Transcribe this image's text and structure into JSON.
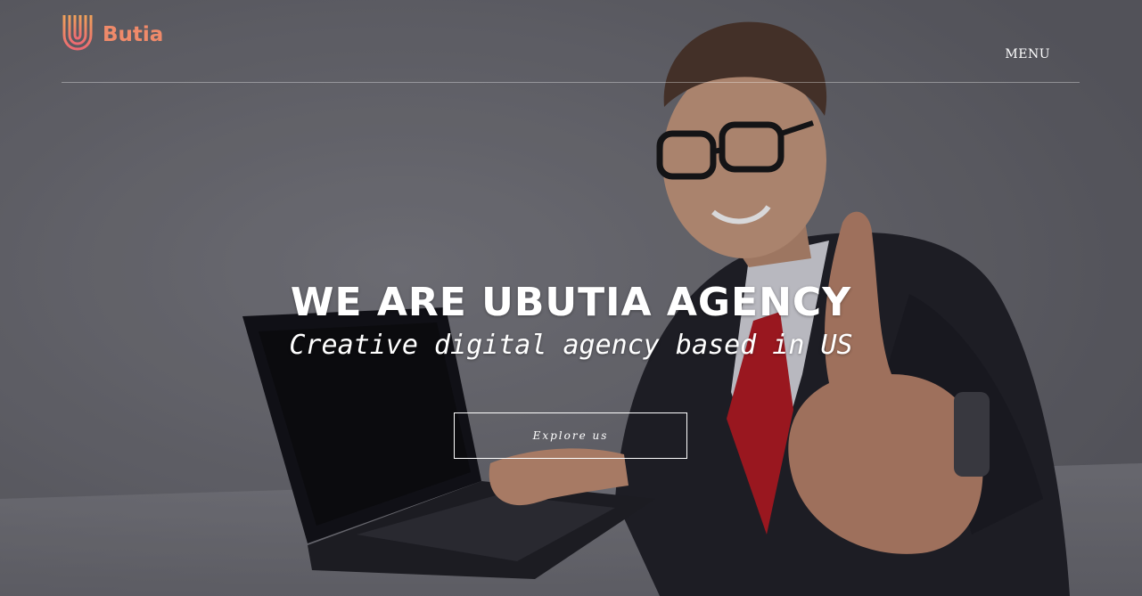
{
  "brand": {
    "logo_letter": "U",
    "name": "Butia",
    "color": "#ef8a6a"
  },
  "nav": {
    "menu_label": "MENU"
  },
  "hero": {
    "headline": "WE ARE UBUTIA AGENCY",
    "tagline": "Creative digital agency based in US",
    "cta_label": "Explore us",
    "background_icon": "man-with-laptop-thumbs-up-photo"
  }
}
